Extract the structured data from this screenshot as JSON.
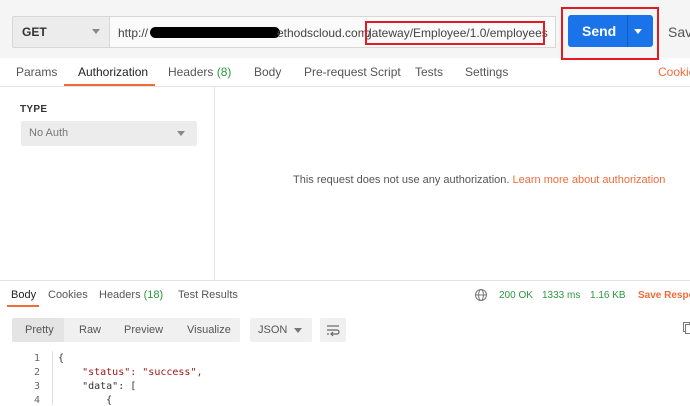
{
  "request": {
    "method": "GET",
    "url_prefix": "http://",
    "url_mid": "ethodscloud.com/",
    "url_path": "gateway/Employee/1.0/employees",
    "send_label": "Send",
    "save_label": "Save"
  },
  "tabs": [
    {
      "label": "Params"
    },
    {
      "label": "Authorization"
    },
    {
      "label": "Headers",
      "count": "(8)"
    },
    {
      "label": "Body"
    },
    {
      "label": "Pre-request Script"
    },
    {
      "label": "Tests"
    },
    {
      "label": "Settings"
    }
  ],
  "cookies_link": "Cookie",
  "auth": {
    "type_label": "TYPE",
    "selected": "No Auth",
    "message": "This request does not use any authorization.",
    "learn_more": "Learn more about authorization"
  },
  "response": {
    "tabs": [
      {
        "label": "Body"
      },
      {
        "label": "Cookies"
      },
      {
        "label": "Headers",
        "count": "(18)"
      },
      {
        "label": "Test Results"
      }
    ],
    "status": "200 OK",
    "time": "1333 ms",
    "size": "1.16 KB",
    "save_label": "Save Respo",
    "views": [
      "Pretty",
      "Raw",
      "Preview",
      "Visualize"
    ],
    "format": "JSON",
    "lines": [
      {
        "n": "1",
        "text": "{"
      },
      {
        "n": "2",
        "text": "    \"status\": \"success\","
      },
      {
        "n": "3",
        "text": "    \"data\": ["
      },
      {
        "n": "4",
        "text": "        {"
      }
    ]
  },
  "colors": {
    "accent": "#f26b3a",
    "send": "#1a73e8",
    "success": "#2b9940",
    "highlight": "#e01b24"
  }
}
